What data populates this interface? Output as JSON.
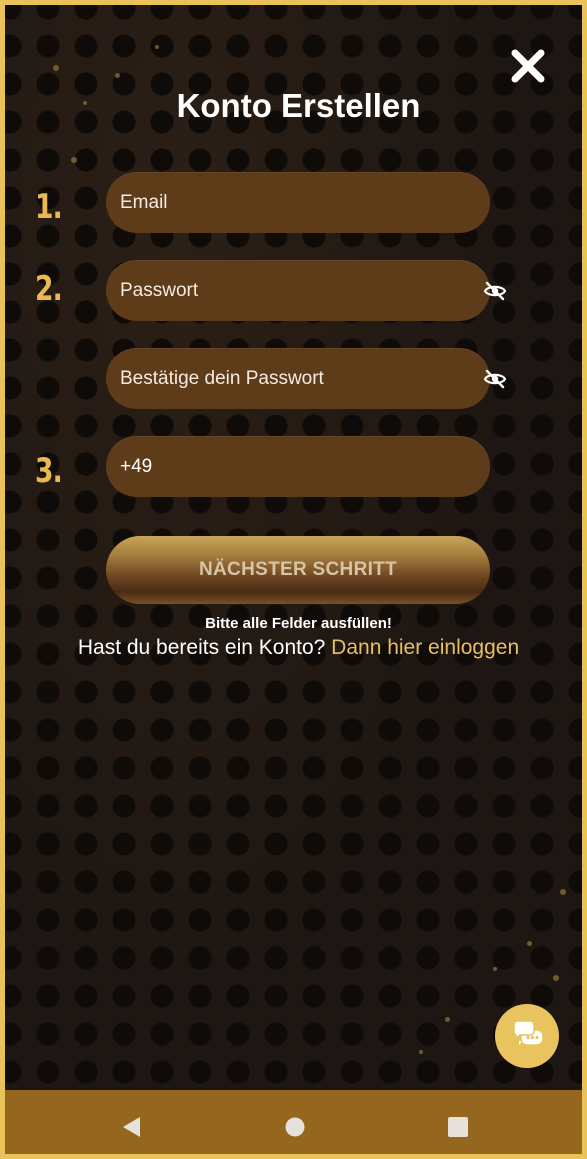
{
  "header": {
    "title": "Konto Erstellen",
    "close_icon": "close-icon"
  },
  "steps": {
    "step1": "1.",
    "step2": "2.",
    "step3": "3."
  },
  "form": {
    "email_placeholder": "Email",
    "email_value": "",
    "password_placeholder": "Passwort",
    "password_value": "",
    "confirm_placeholder": "Bestätige dein Passwort",
    "confirm_value": "",
    "phone_value": "+49",
    "eye_icon": "eye-off-icon"
  },
  "actions": {
    "next_label": "NÄCHSTER SCHRITT",
    "hint": "Bitte alle Felder ausfüllen!",
    "login_prompt": "Hast du bereits ein Konto? ",
    "login_link": "Dann hier einloggen"
  },
  "chat": {
    "icon": "chat-bubbles-icon"
  },
  "system_nav": {
    "back_icon": "back-icon",
    "home_icon": "home-icon",
    "recents_icon": "recents-icon"
  },
  "colors": {
    "frame": "#e9c25a",
    "accent": "#e9bf63",
    "field": "#5e3b19",
    "navbar": "#95671e",
    "background": "#1d1612"
  }
}
